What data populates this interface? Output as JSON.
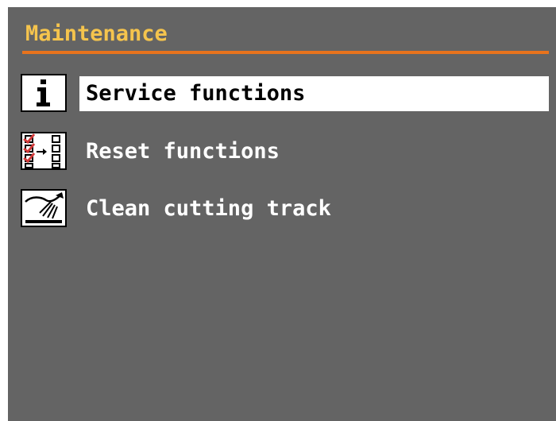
{
  "header": {
    "title": "Maintenance"
  },
  "menu": {
    "items": [
      {
        "label": "Service functions",
        "icon": "info-icon",
        "selected": true
      },
      {
        "label": "Reset functions",
        "icon": "reset-checklist-icon",
        "selected": false
      },
      {
        "label": "Clean cutting track",
        "icon": "spray-clean-icon",
        "selected": false
      }
    ]
  },
  "colors": {
    "background": "#646464",
    "title": "#f5c44d",
    "divider": "#e8731c",
    "selected_background": "#ffffff",
    "text": "#ffffff"
  }
}
